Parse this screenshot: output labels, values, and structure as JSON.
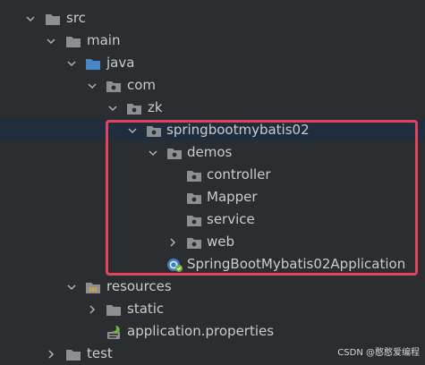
{
  "tree": {
    "nodes": [
      {
        "label": "src",
        "icon": "folder-icon"
      },
      {
        "label": "main",
        "icon": "folder-icon"
      },
      {
        "label": "java",
        "icon": "source-folder-icon"
      },
      {
        "label": "com",
        "icon": "package-icon"
      },
      {
        "label": "zk",
        "icon": "package-icon"
      },
      {
        "label": "springbootmybatis02",
        "icon": "package-icon"
      },
      {
        "label": "demos",
        "icon": "package-icon"
      },
      {
        "label": "controller",
        "icon": "package-icon"
      },
      {
        "label": "Mapper",
        "icon": "package-icon"
      },
      {
        "label": "service",
        "icon": "package-icon"
      },
      {
        "label": "web",
        "icon": "package-icon"
      },
      {
        "label": "SpringBootMybatis02Application",
        "icon": "spring-boot-class-icon"
      },
      {
        "label": "resources",
        "icon": "resources-folder-icon"
      },
      {
        "label": "static",
        "icon": "folder-icon"
      },
      {
        "label": "application.properties",
        "icon": "spring-properties-icon"
      },
      {
        "label": "test",
        "icon": "folder-icon"
      }
    ]
  },
  "colors": {
    "background": "#2b2d30",
    "selection": "#1f2d3c",
    "highlight_border": "#e0445c",
    "folder": "#8c8f94",
    "source_folder": "#4a86c7",
    "spring_green": "#6db33f"
  },
  "watermark": "CSDN @憨憨爱编程"
}
